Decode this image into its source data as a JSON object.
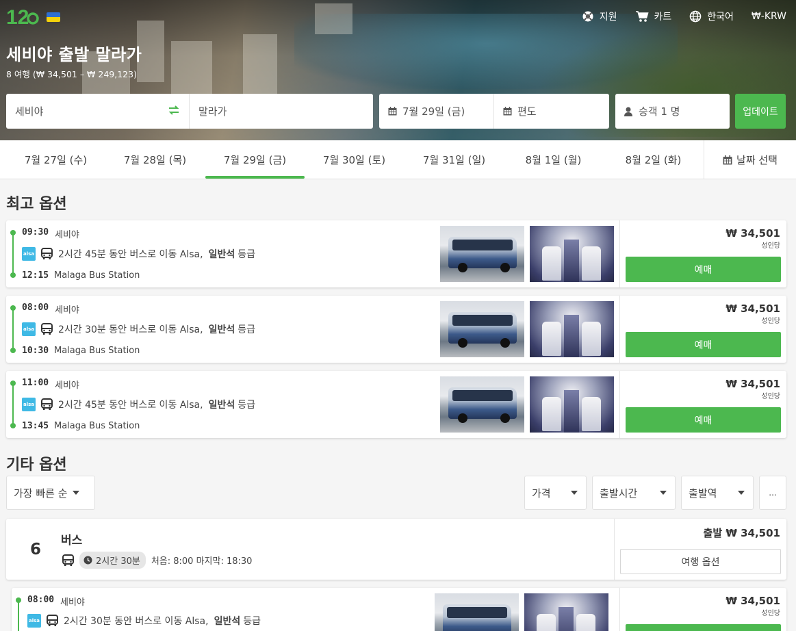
{
  "header": {
    "nav": [
      {
        "label": "지원",
        "icon": "lifebuoy-icon"
      },
      {
        "label": "카트",
        "icon": "cart-icon"
      },
      {
        "label": "한국어",
        "icon": "globe-icon"
      },
      {
        "label": "₩-KRW",
        "icon": ""
      }
    ],
    "title": "세비야 출발 말라가",
    "subtitle": "8 여행 (₩ 34,501 – ₩ 249,123)"
  },
  "search": {
    "from": "세비야",
    "to": "말라가",
    "date": "7월 29일 (금)",
    "trip_type": "편도",
    "passengers": "승객 1 명",
    "update_label": "업데이트"
  },
  "dates": {
    "tabs": [
      "7월 27일 (수)",
      "7월 28일 (목)",
      "7월 29일 (금)",
      "7월 30일 (토)",
      "7월 31일 (일)",
      "8월 1일 (월)",
      "8월 2일 (화)"
    ],
    "active_index": 2,
    "pick_label": "날짜 선택"
  },
  "best": {
    "title": "최고 옵션",
    "trips": [
      {
        "dep_time": "09:30",
        "dep_place": "세비야",
        "desc": "2시간 45분 동안 버스로 이동 Alsa,",
        "class": "일반석",
        "class_suffix": "등급",
        "arr_time": "12:15",
        "arr_place": "Malaga Bus Station",
        "price": "₩ 34,501",
        "per": "성인당",
        "book": "예매"
      },
      {
        "dep_time": "08:00",
        "dep_place": "세비야",
        "desc": "2시간 30분 동안 버스로 이동 Alsa,",
        "class": "일반석",
        "class_suffix": "등급",
        "arr_time": "10:30",
        "arr_place": "Malaga Bus Station",
        "price": "₩ 34,501",
        "per": "성인당",
        "book": "예매"
      },
      {
        "dep_time": "11:00",
        "dep_place": "세비야",
        "desc": "2시간 45분 동안 버스로 이동 Alsa,",
        "class": "일반석",
        "class_suffix": "등급",
        "arr_time": "13:45",
        "arr_place": "Malaga Bus Station",
        "price": "₩ 34,501",
        "per": "성인당",
        "book": "예매"
      }
    ]
  },
  "other": {
    "title": "기타 옵션",
    "sort": "가장 빠른 순",
    "filters": [
      "가격",
      "출발시간",
      "출발역"
    ],
    "more": "..."
  },
  "group": {
    "count": "6",
    "title": "버스",
    "duration": "2시간 30분",
    "first_last": "처음: 8:00 마지막: 18:30",
    "price": "출발 ₩ 34,501",
    "button": "여행 옵션"
  },
  "sub_trip": {
    "dep_time": "08:00",
    "dep_place": "세비야",
    "desc": "2시간 30분 동안 버스로 이동 Alsa,",
    "class": "일반석",
    "class_suffix": "등급",
    "price": "₩ 34,501",
    "per": "성인당"
  },
  "operator_logo": "alsa",
  "colors": {
    "accent": "#4cb84f",
    "alsa": "#3fb9e5"
  }
}
